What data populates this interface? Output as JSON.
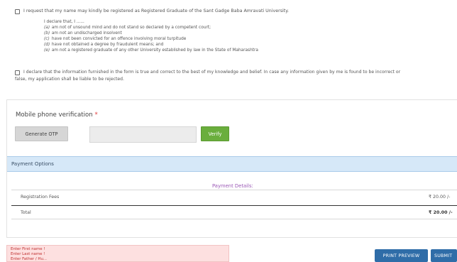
{
  "declaration1": {
    "text": "I request that my name may kindly be registered as Registered Graduate of the Sant Gadge Baba Amravati University.",
    "intro": "I declare that, I ......",
    "items": [
      {
        "marker": "(a)",
        "text": "am not of unsound mind and do not stand so declared by a competent court;"
      },
      {
        "marker": "(b)",
        "text": "am not an undischarged insolvent"
      },
      {
        "marker": "(c)",
        "text": "have not been convicted for an offence involving moral turpitude"
      },
      {
        "marker": "(d)",
        "text": "have not obtained a degree by fraudulent means; and"
      },
      {
        "marker": "(e)",
        "text": "am not a registered graduate of any other University established by law in the State of Maharashtra"
      }
    ]
  },
  "declaration2": {
    "line1": "I declare that the information furnished in the form is true and correct to the best of my knowledge and belief. In case any information given by me is found to be incorrect or",
    "line2": "false, my application shall be liable to be rejected."
  },
  "verification": {
    "label": "Mobile phone verification",
    "required_marker": "*",
    "generate_otp_label": "Generate OTP",
    "otp_value": "",
    "verify_label": "Verify"
  },
  "payment": {
    "header": "Payment Options",
    "details_title": "Payment Details:",
    "fee_label": "Registration Fees",
    "fee_amount": "₹ 20.00 /-",
    "total_label": "Total",
    "total_amount": "₹ 20.00 /-"
  },
  "errors": [
    "Enter First name !",
    "Enter Last name !",
    "Enter Father / Hu..."
  ],
  "actions": {
    "print_preview_label": "PRINT PREVIEW",
    "submit_label": "SUBMIT"
  },
  "colors": {
    "verify_button": "#6aae3d",
    "payment_header_bg": "#d6e8f8",
    "details_title": "#9b59b6",
    "error_text": "#c03030",
    "action_button": "#2f6da8"
  }
}
